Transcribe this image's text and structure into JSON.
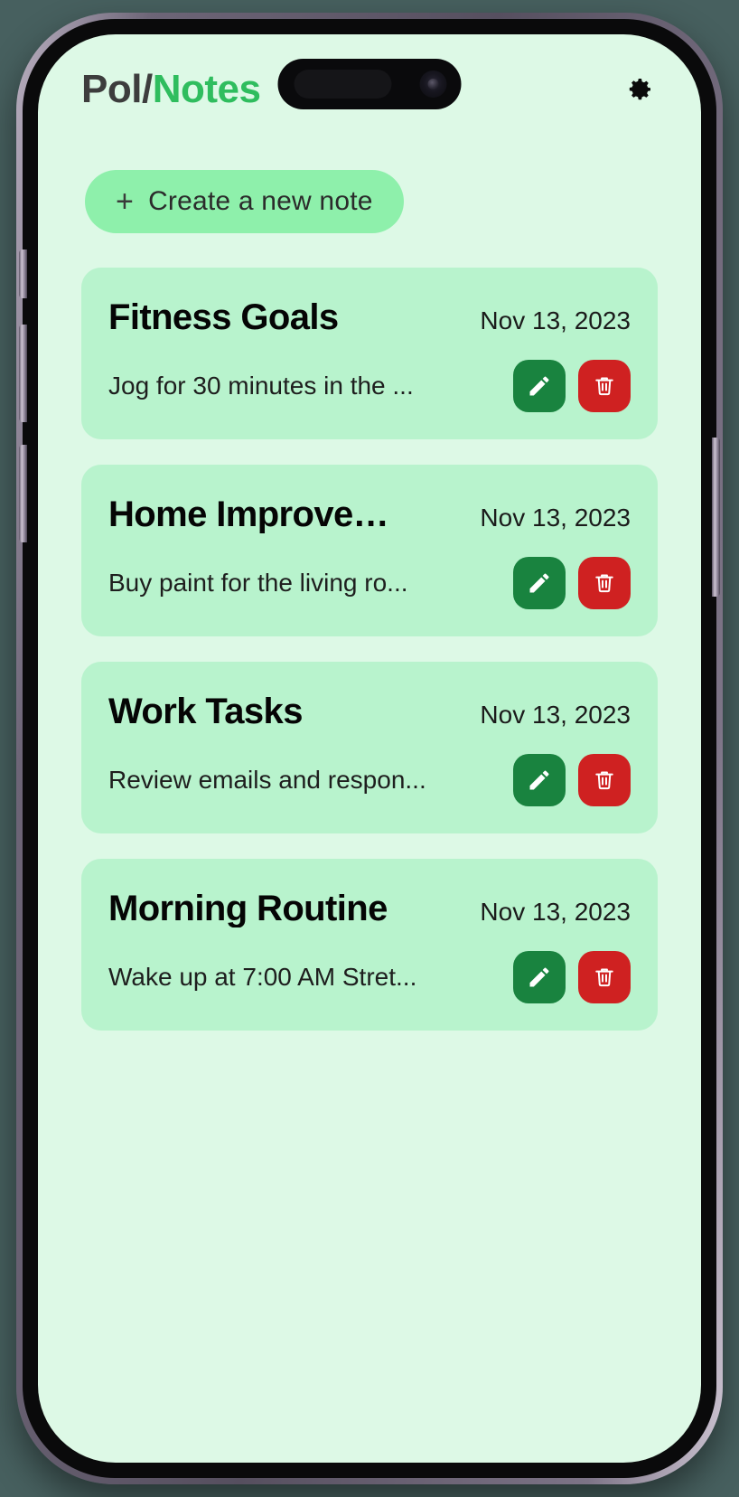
{
  "app": {
    "logo_primary": "Pol/",
    "logo_accent": "Notes",
    "settings_icon": "gear-icon",
    "accent_color": "#2fbd5e",
    "screen_bg": "#ddf9e6",
    "card_bg": "#b8f3cd",
    "edit_color": "#19833f",
    "delete_color": "#cf2121"
  },
  "toolbar": {
    "create_plus": "+",
    "create_label": "Create a new note"
  },
  "notes": [
    {
      "title": "Fitness Goals",
      "date": "Nov 13, 2023",
      "snippet": "Jog for 30 minutes in the ...",
      "edit_icon": "pencil-icon",
      "delete_icon": "trash-icon"
    },
    {
      "title": "Home Improve…",
      "date": "Nov 13, 2023",
      "snippet": "Buy paint for the living ro...",
      "edit_icon": "pencil-icon",
      "delete_icon": "trash-icon"
    },
    {
      "title": "Work Tasks",
      "date": "Nov 13, 2023",
      "snippet": "Review emails and respon...",
      "edit_icon": "pencil-icon",
      "delete_icon": "trash-icon"
    },
    {
      "title": "Morning Routine",
      "date": "Nov 13, 2023",
      "snippet": "Wake up at 7:00 AM Stret...",
      "edit_icon": "pencil-icon",
      "delete_icon": "trash-icon"
    }
  ]
}
